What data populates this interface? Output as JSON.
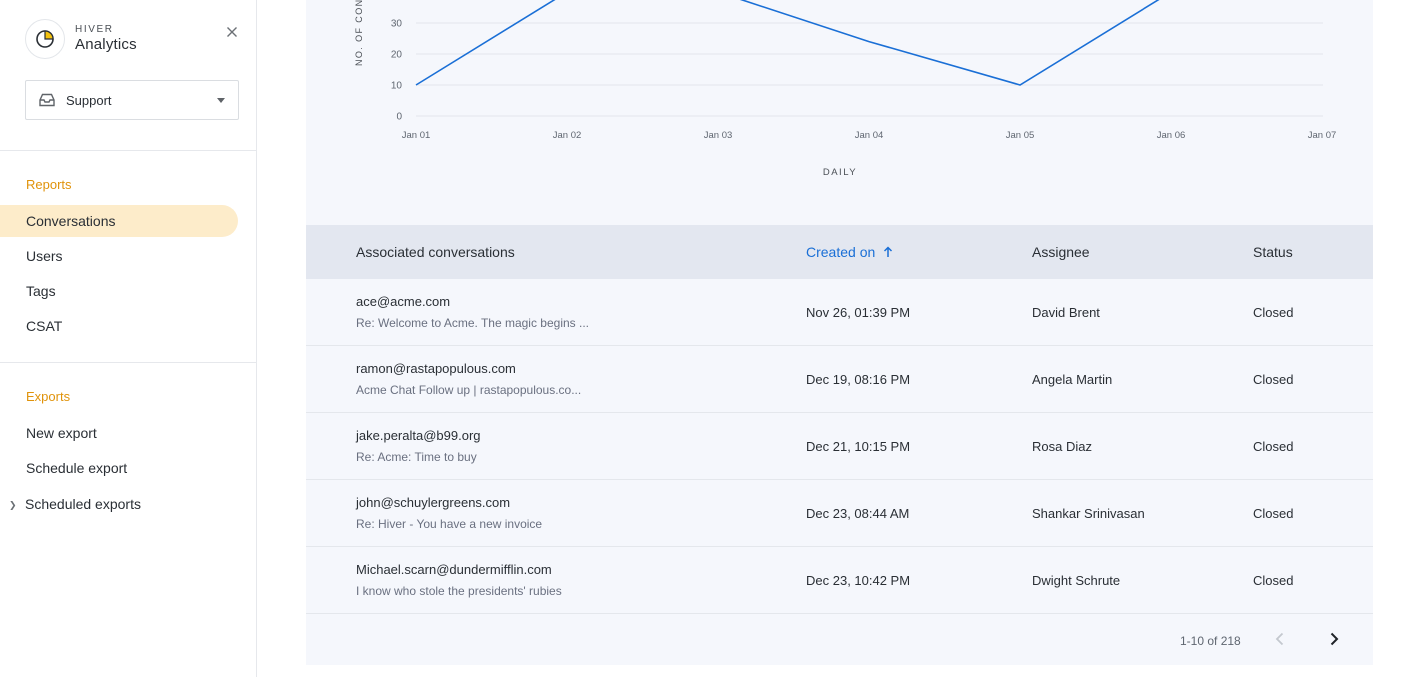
{
  "brand": {
    "small": "HIVER",
    "name": "Analytics"
  },
  "inbox": {
    "selected": "Support"
  },
  "reports": {
    "title": "Reports",
    "items": [
      {
        "label": "Conversations",
        "active": true
      },
      {
        "label": "Users",
        "active": false
      },
      {
        "label": "Tags",
        "active": false
      },
      {
        "label": "CSAT",
        "active": false
      }
    ]
  },
  "exports": {
    "title": "Exports",
    "items": [
      {
        "label": "New export"
      },
      {
        "label": "Schedule export"
      },
      {
        "label": "Scheduled exports"
      }
    ]
  },
  "chart_data": {
    "type": "line",
    "title": "",
    "xlabel": "DAILY",
    "ylabel": "NO. OF CON",
    "x": [
      "Jan 01",
      "Jan 02",
      "Jan 03",
      "Jan 04",
      "Jan 05",
      "Jan 06",
      "Jan 07"
    ],
    "y_ticks": [
      0,
      10,
      20,
      30
    ],
    "series": [
      {
        "values": [
          10,
          40,
          40,
          24,
          10,
          40,
          null
        ]
      }
    ],
    "ylim": [
      0,
      40
    ],
    "grid": true,
    "colors": {
      "line": "#1a6fd6",
      "grid": "#e2e5ec"
    }
  },
  "table": {
    "headers": {
      "conversation": "Associated conversations",
      "created": "Created on",
      "assignee": "Assignee",
      "status": "Status"
    },
    "sort_icon": "arrow-up-icon",
    "rows": [
      {
        "email": "ace@acme.com",
        "subject": "Re: Welcome to Acme. The magic begins ...",
        "created": "Nov 26, 01:39 PM",
        "assignee": "David Brent",
        "status": "Closed"
      },
      {
        "email": "ramon@rastapopulous.com",
        "subject": "Acme Chat Follow up | rastapopulous.co...",
        "created": "Dec 19, 08:16 PM",
        "assignee": "Angela Martin",
        "status": "Closed"
      },
      {
        "email": "jake.peralta@b99.org",
        "subject": "Re: Acme: Time to buy",
        "created": "Dec 21, 10:15 PM",
        "assignee": "Rosa Diaz",
        "status": "Closed"
      },
      {
        "email": "john@schuylergreens.com",
        "subject": "Re: Hiver - You have a new invoice",
        "created": "Dec 23, 08:44 AM",
        "assignee": "Shankar Srinivasan",
        "status": "Closed"
      },
      {
        "email": "Michael.scarn@dundermifflin.com",
        "subject": "I know who stole the presidents' rubies",
        "created": "Dec 23, 10:42 PM",
        "assignee": "Dwight Schrute",
        "status": "Closed"
      }
    ]
  },
  "pager": {
    "range": "1-10 of 218"
  },
  "colors": {
    "accent": "#1a6fd6",
    "section": "#e0930b",
    "active_bg": "#fdecca"
  }
}
